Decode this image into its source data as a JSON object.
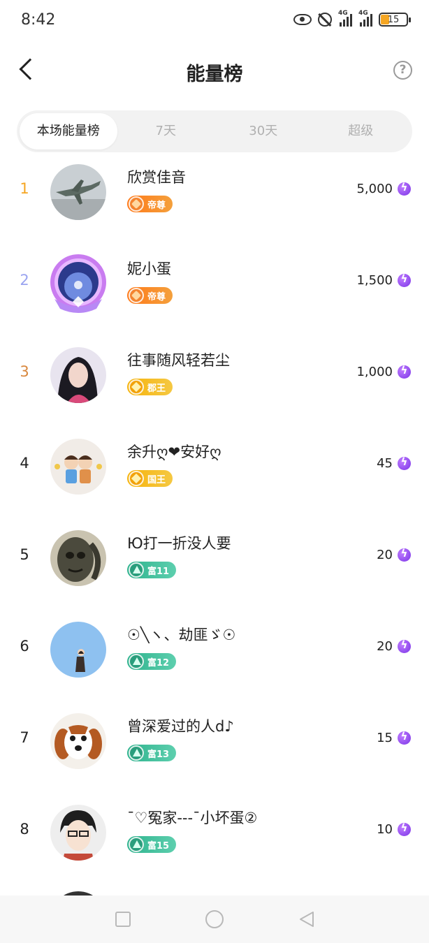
{
  "status_bar": {
    "time": "8:42",
    "network_1": "4G",
    "network_2": "4G",
    "battery": "15"
  },
  "header": {
    "title": "能量榜",
    "help_symbol": "?"
  },
  "tabs": [
    {
      "label": "本场能量榜",
      "active": true
    },
    {
      "label": "7天",
      "active": false
    },
    {
      "label": "30天",
      "active": false
    },
    {
      "label": "超级",
      "active": false
    }
  ],
  "colors": {
    "rank_1": "#f5a623",
    "rank_2": "#9aa4f0",
    "rank_3": "#d8873d",
    "rank_default": "#222222",
    "energy": "#8a3cf0"
  },
  "ranking": [
    {
      "rank": "1",
      "name": "欣赏佳音",
      "badge": "帝尊",
      "badge_type": "emperor",
      "score": "5,000",
      "avatar": "plane"
    },
    {
      "rank": "2",
      "name": "妮小蛋",
      "badge": "帝尊",
      "badge_type": "emperor",
      "score": "1,500",
      "avatar": "crystal-frame"
    },
    {
      "rank": "3",
      "name": "往事随风轻若尘",
      "badge": "郡王",
      "badge_type": "king",
      "score": "1,000",
      "avatar": "woman"
    },
    {
      "rank": "4",
      "name": "余升ღ❤安好ღ",
      "badge": "国王",
      "badge_type": "king",
      "score": "45",
      "avatar": "cartoon-couple"
    },
    {
      "rank": "5",
      "name": "Ю打一折没人要",
      "badge": "富11",
      "badge_type": "rich",
      "score": "20",
      "avatar": "dark-face"
    },
    {
      "rank": "6",
      "name": "☉╲ヽ、劫匪ゞ☉",
      "badge": "富12",
      "badge_type": "rich",
      "score": "20",
      "avatar": "blue-figure"
    },
    {
      "rank": "7",
      "name": "曾深爱过的人d♪",
      "badge": "富13",
      "badge_type": "rich",
      "score": "15",
      "avatar": "puppy"
    },
    {
      "rank": "8",
      "name": "ˉ♡冤家---ˉ小坏蛋②",
      "badge": "富15",
      "badge_type": "rich",
      "score": "10",
      "avatar": "anime-boy"
    }
  ]
}
